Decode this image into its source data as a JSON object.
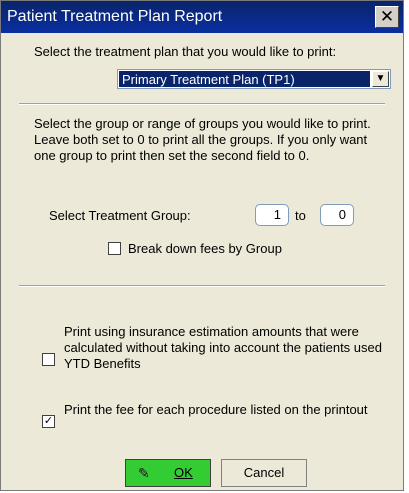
{
  "dialog": {
    "title": "Patient Treatment Plan Report",
    "close_glyph": "✕"
  },
  "plan": {
    "prompt": "Select the treatment plan that you would like to print:",
    "selected": "Primary Treatment Plan (TP1)",
    "dropdown_glyph": "▼"
  },
  "groups": {
    "instructions": "Select the group or range of groups you would like to print.  Leave both set to 0 to print all the groups.  If you only want one group to print then set the second field to 0.",
    "select_label": "Select Treatment Group:",
    "from_value": "1",
    "to_label": "to",
    "to_value": "0",
    "breakdown_label": "Break down fees by Group",
    "breakdown_checked": false
  },
  "options": {
    "insurance_label": "Print using insurance estimation amounts that were calculated without taking into account the patients used YTD Benefits",
    "insurance_checked": false,
    "fee_label": "Print the fee for each procedure listed on the printout",
    "fee_checked": true,
    "check_glyph": "✓"
  },
  "buttons": {
    "ok_label": "OK",
    "ok_icon": "pen-icon",
    "cancel_label": "Cancel"
  },
  "colors": {
    "title_bar": "#0a246a",
    "ok_button": "#33cc33",
    "dialog_bg": "#ece9d8"
  }
}
